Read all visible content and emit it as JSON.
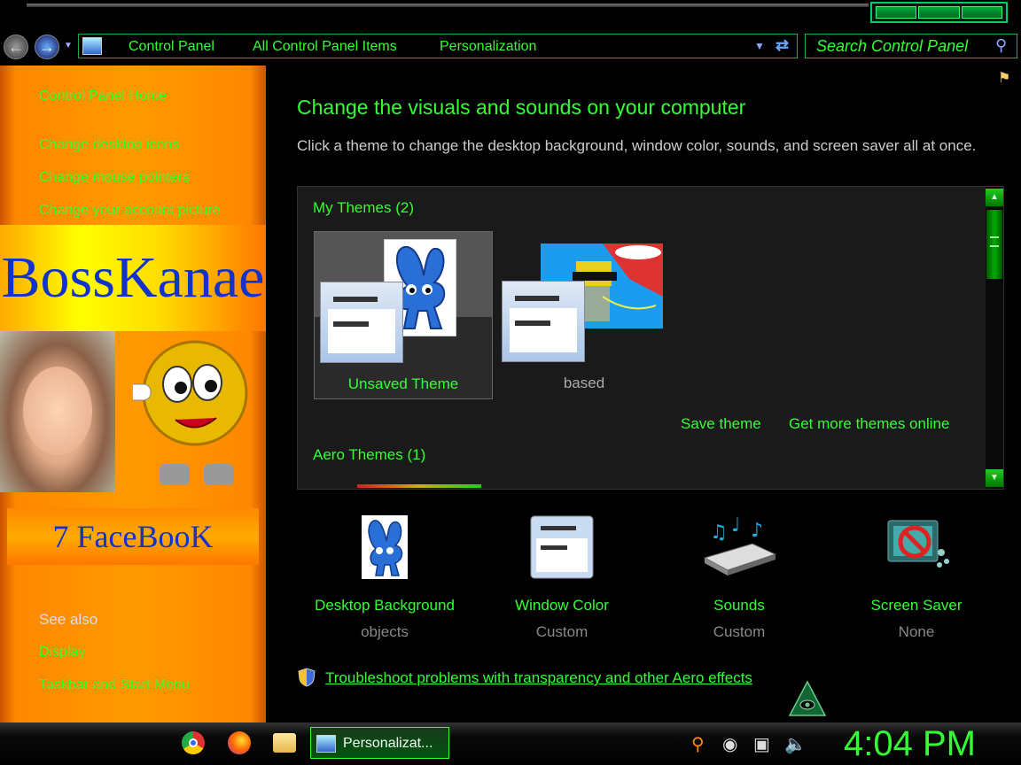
{
  "window": {
    "controls": [
      "minimize",
      "maximize",
      "close"
    ]
  },
  "nav": {
    "back_icon": "back-arrow-icon",
    "forward_icon": "forward-arrow-icon"
  },
  "address": {
    "crumbs": [
      "Control Panel",
      "All Control Panel Items",
      "Personalization"
    ]
  },
  "search": {
    "placeholder": "Search Control Panel"
  },
  "sidebar": {
    "home": "Control Panel Home",
    "links": [
      "Change desktop icons",
      "Change mouse pointers",
      "Change your account picture"
    ],
    "banner_top": "BossKanae",
    "banner_bottom": "7 FaceBooK",
    "see_also": "See also",
    "see_also_links": [
      "Display",
      "Taskbar and Start Menu"
    ]
  },
  "main": {
    "title": "Change the visuals and sounds on your computer",
    "description": "Click a theme to change the desktop background, window color, sounds, and screen saver all at once.",
    "my_themes_label": "My Themes (2)",
    "themes": [
      {
        "name": "Unsaved Theme"
      },
      {
        "name": "based"
      }
    ],
    "save_theme": "Save theme",
    "get_more": "Get more themes online",
    "aero_label": "Aero Themes (1)",
    "bottom": [
      {
        "label": "Desktop Background",
        "sub": "objects"
      },
      {
        "label": "Window Color",
        "sub": "Custom"
      },
      {
        "label": "Sounds",
        "sub": "Custom"
      },
      {
        "label": "Screen Saver",
        "sub": "None"
      }
    ],
    "troubleshoot": "Troubleshoot problems with transparency and other Aero effects"
  },
  "taskbar": {
    "active_task": "Personalizat...",
    "clock": "4:04 PM"
  },
  "colors": {
    "accent": "#33ff33",
    "sidebar": "#ff8800",
    "background": "#000000"
  }
}
